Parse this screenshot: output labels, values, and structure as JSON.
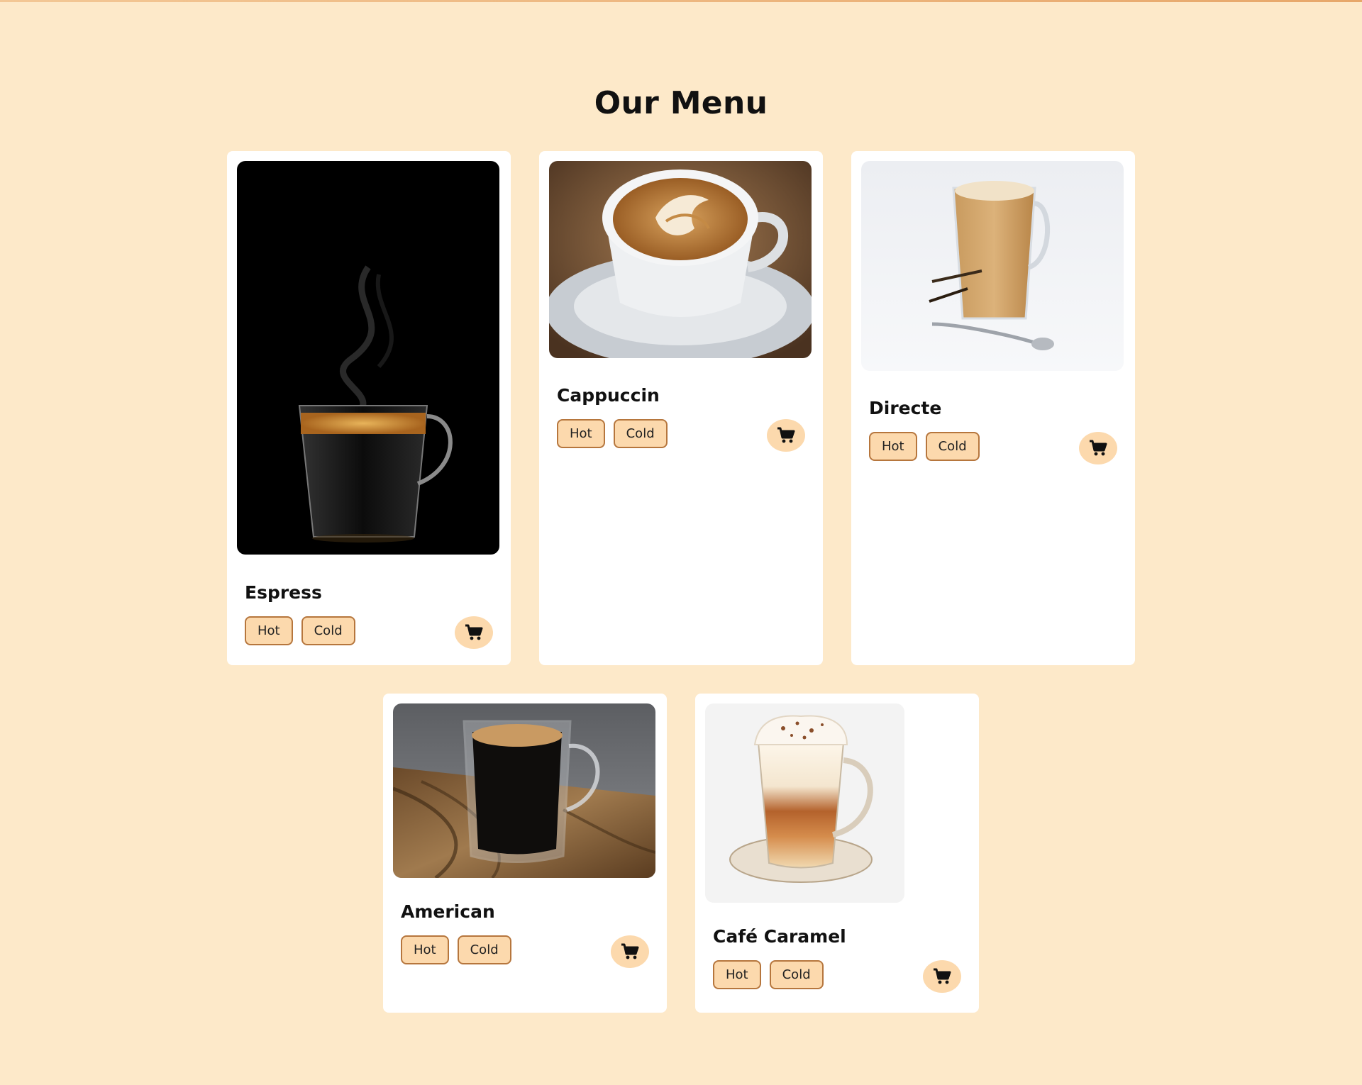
{
  "page": {
    "title": "Our Menu"
  },
  "colors": {
    "background": "#fde9c9",
    "tag_fill": "#fcd9ad",
    "tag_border": "#b6763d",
    "card": "#ffffff"
  },
  "menu": {
    "items": [
      {
        "name": "Espress",
        "image": "espresso-glass-cup-image",
        "tags": [
          "Hot",
          "Cold"
        ],
        "cart_icon": "cart-icon"
      },
      {
        "name": "Cappuccin",
        "image": "latte-art-cup-image",
        "tags": [
          "Hot",
          "Cold"
        ],
        "cart_icon": "cart-icon"
      },
      {
        "name": "Directe",
        "image": "latte-tall-glass-image",
        "tags": [
          "Hot",
          "Cold"
        ],
        "cart_icon": "cart-icon"
      },
      {
        "name": "American",
        "image": "americano-glass-mug-image",
        "tags": [
          "Hot",
          "Cold"
        ],
        "cart_icon": "cart-icon"
      },
      {
        "name": "Café Caramel",
        "image": "caramel-coffee-illustration-image",
        "tags": [
          "Hot",
          "Cold"
        ],
        "cart_icon": "cart-icon"
      }
    ]
  }
}
